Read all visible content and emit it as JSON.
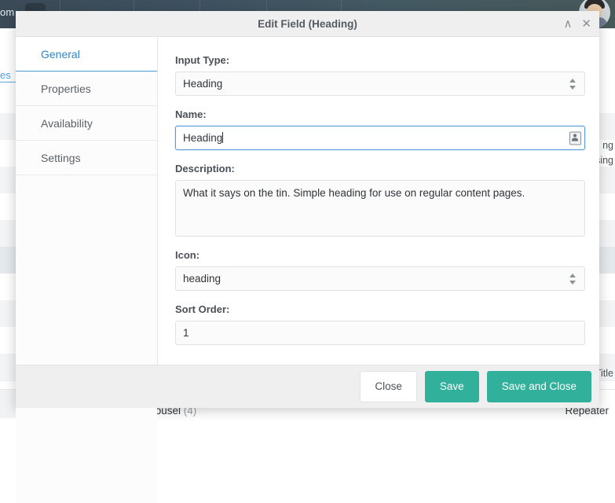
{
  "background": {
    "brand_text_fragment": "om",
    "left_link_fragment": "es",
    "right_text_fragments": [
      "ng",
      "sing"
    ],
    "title_fragment": "Title",
    "row_label": "Carousel",
    "row_count": "(4)",
    "row_type": "Repeater",
    "avatar": "user-avatar"
  },
  "modal": {
    "title": "Edit Field (Heading)",
    "header_actions": {
      "collapse_label": "∧",
      "close_label": "✕"
    },
    "tabs": [
      {
        "label": "General",
        "active": true
      },
      {
        "label": "Properties",
        "active": false
      },
      {
        "label": "Availability",
        "active": false
      },
      {
        "label": "Settings",
        "active": false
      }
    ],
    "fields": {
      "input_type": {
        "label": "Input Type:",
        "value": "Heading",
        "options": [
          "Heading"
        ]
      },
      "name": {
        "label": "Name:",
        "value": "Heading",
        "placeholder": "",
        "focused": true,
        "icon": "contact-card-icon"
      },
      "description": {
        "label": "Description:",
        "value": "What it says on the tin. Simple heading for use on regular content pages.",
        "placeholder": ""
      },
      "icon": {
        "label": "Icon:",
        "value": "heading",
        "options": [
          "heading"
        ]
      },
      "sort_order": {
        "label": "Sort Order:",
        "value": "1",
        "placeholder": ""
      }
    },
    "footer": {
      "close_label": "Close",
      "save_label": "Save",
      "save_and_close_label": "Save and Close"
    }
  },
  "colors": {
    "primary": "#31b09b",
    "accent_link": "#2f87c9",
    "topbar": "#3f5261",
    "header_bg": "#efefef"
  }
}
